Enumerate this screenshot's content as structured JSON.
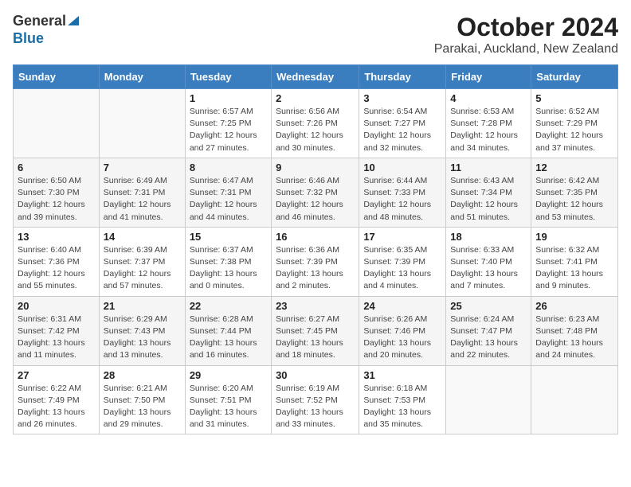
{
  "logo": {
    "line1": "General",
    "line2": "Blue"
  },
  "title": "October 2024",
  "subtitle": "Parakai, Auckland, New Zealand",
  "headers": [
    "Sunday",
    "Monday",
    "Tuesday",
    "Wednesday",
    "Thursday",
    "Friday",
    "Saturday"
  ],
  "weeks": [
    [
      {
        "day": "",
        "detail": ""
      },
      {
        "day": "",
        "detail": ""
      },
      {
        "day": "1",
        "detail": "Sunrise: 6:57 AM\nSunset: 7:25 PM\nDaylight: 12 hours\nand 27 minutes."
      },
      {
        "day": "2",
        "detail": "Sunrise: 6:56 AM\nSunset: 7:26 PM\nDaylight: 12 hours\nand 30 minutes."
      },
      {
        "day": "3",
        "detail": "Sunrise: 6:54 AM\nSunset: 7:27 PM\nDaylight: 12 hours\nand 32 minutes."
      },
      {
        "day": "4",
        "detail": "Sunrise: 6:53 AM\nSunset: 7:28 PM\nDaylight: 12 hours\nand 34 minutes."
      },
      {
        "day": "5",
        "detail": "Sunrise: 6:52 AM\nSunset: 7:29 PM\nDaylight: 12 hours\nand 37 minutes."
      }
    ],
    [
      {
        "day": "6",
        "detail": "Sunrise: 6:50 AM\nSunset: 7:30 PM\nDaylight: 12 hours\nand 39 minutes."
      },
      {
        "day": "7",
        "detail": "Sunrise: 6:49 AM\nSunset: 7:31 PM\nDaylight: 12 hours\nand 41 minutes."
      },
      {
        "day": "8",
        "detail": "Sunrise: 6:47 AM\nSunset: 7:31 PM\nDaylight: 12 hours\nand 44 minutes."
      },
      {
        "day": "9",
        "detail": "Sunrise: 6:46 AM\nSunset: 7:32 PM\nDaylight: 12 hours\nand 46 minutes."
      },
      {
        "day": "10",
        "detail": "Sunrise: 6:44 AM\nSunset: 7:33 PM\nDaylight: 12 hours\nand 48 minutes."
      },
      {
        "day": "11",
        "detail": "Sunrise: 6:43 AM\nSunset: 7:34 PM\nDaylight: 12 hours\nand 51 minutes."
      },
      {
        "day": "12",
        "detail": "Sunrise: 6:42 AM\nSunset: 7:35 PM\nDaylight: 12 hours\nand 53 minutes."
      }
    ],
    [
      {
        "day": "13",
        "detail": "Sunrise: 6:40 AM\nSunset: 7:36 PM\nDaylight: 12 hours\nand 55 minutes."
      },
      {
        "day": "14",
        "detail": "Sunrise: 6:39 AM\nSunset: 7:37 PM\nDaylight: 12 hours\nand 57 minutes."
      },
      {
        "day": "15",
        "detail": "Sunrise: 6:37 AM\nSunset: 7:38 PM\nDaylight: 13 hours\nand 0 minutes."
      },
      {
        "day": "16",
        "detail": "Sunrise: 6:36 AM\nSunset: 7:39 PM\nDaylight: 13 hours\nand 2 minutes."
      },
      {
        "day": "17",
        "detail": "Sunrise: 6:35 AM\nSunset: 7:39 PM\nDaylight: 13 hours\nand 4 minutes."
      },
      {
        "day": "18",
        "detail": "Sunrise: 6:33 AM\nSunset: 7:40 PM\nDaylight: 13 hours\nand 7 minutes."
      },
      {
        "day": "19",
        "detail": "Sunrise: 6:32 AM\nSunset: 7:41 PM\nDaylight: 13 hours\nand 9 minutes."
      }
    ],
    [
      {
        "day": "20",
        "detail": "Sunrise: 6:31 AM\nSunset: 7:42 PM\nDaylight: 13 hours\nand 11 minutes."
      },
      {
        "day": "21",
        "detail": "Sunrise: 6:29 AM\nSunset: 7:43 PM\nDaylight: 13 hours\nand 13 minutes."
      },
      {
        "day": "22",
        "detail": "Sunrise: 6:28 AM\nSunset: 7:44 PM\nDaylight: 13 hours\nand 16 minutes."
      },
      {
        "day": "23",
        "detail": "Sunrise: 6:27 AM\nSunset: 7:45 PM\nDaylight: 13 hours\nand 18 minutes."
      },
      {
        "day": "24",
        "detail": "Sunrise: 6:26 AM\nSunset: 7:46 PM\nDaylight: 13 hours\nand 20 minutes."
      },
      {
        "day": "25",
        "detail": "Sunrise: 6:24 AM\nSunset: 7:47 PM\nDaylight: 13 hours\nand 22 minutes."
      },
      {
        "day": "26",
        "detail": "Sunrise: 6:23 AM\nSunset: 7:48 PM\nDaylight: 13 hours\nand 24 minutes."
      }
    ],
    [
      {
        "day": "27",
        "detail": "Sunrise: 6:22 AM\nSunset: 7:49 PM\nDaylight: 13 hours\nand 26 minutes."
      },
      {
        "day": "28",
        "detail": "Sunrise: 6:21 AM\nSunset: 7:50 PM\nDaylight: 13 hours\nand 29 minutes."
      },
      {
        "day": "29",
        "detail": "Sunrise: 6:20 AM\nSunset: 7:51 PM\nDaylight: 13 hours\nand 31 minutes."
      },
      {
        "day": "30",
        "detail": "Sunrise: 6:19 AM\nSunset: 7:52 PM\nDaylight: 13 hours\nand 33 minutes."
      },
      {
        "day": "31",
        "detail": "Sunrise: 6:18 AM\nSunset: 7:53 PM\nDaylight: 13 hours\nand 35 minutes."
      },
      {
        "day": "",
        "detail": ""
      },
      {
        "day": "",
        "detail": ""
      }
    ]
  ]
}
